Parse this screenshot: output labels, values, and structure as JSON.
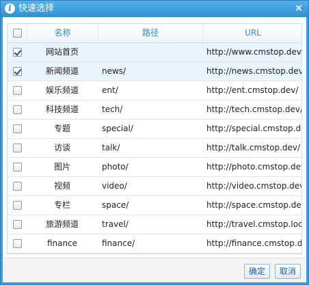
{
  "dialog": {
    "title": "快速选择",
    "info_icon": "i",
    "close_icon": "×"
  },
  "table": {
    "headers": {
      "name": "名称",
      "path": "路径",
      "url": "URL"
    },
    "rows": [
      {
        "checked": true,
        "name": "网站首页",
        "path": "",
        "url": "http://www.cmstop.dev/"
      },
      {
        "checked": true,
        "name": "新闻频道",
        "path": "news/",
        "url": "http://news.cmstop.dev/"
      },
      {
        "checked": false,
        "name": "娱乐频道",
        "path": "ent/",
        "url": "http://ent.cmstop.dev/"
      },
      {
        "checked": false,
        "name": "科技频道",
        "path": "tech/",
        "url": "http://tech.cmstop.dev/"
      },
      {
        "checked": false,
        "name": "专题",
        "path": "special/",
        "url": "http://special.cmstop.dev/"
      },
      {
        "checked": false,
        "name": "访谈",
        "path": "talk/",
        "url": "http://talk.cmstop.dev/"
      },
      {
        "checked": false,
        "name": "图片",
        "path": "photo/",
        "url": "http://photo.cmstop.dev/"
      },
      {
        "checked": false,
        "name": "视频",
        "path": "video/",
        "url": "http://video.cmstop.dev/"
      },
      {
        "checked": false,
        "name": "专栏",
        "path": "space/",
        "url": "http://space.cmstop.dev/"
      },
      {
        "checked": false,
        "name": "旅游频道",
        "path": "travel/",
        "url": "http://travel.cmstop.loc"
      },
      {
        "checked": false,
        "name": "finance",
        "path": "finance/",
        "url": "http://finance.cmstop.dev"
      }
    ]
  },
  "buttons": {
    "ok": "确定",
    "cancel": "取消"
  }
}
